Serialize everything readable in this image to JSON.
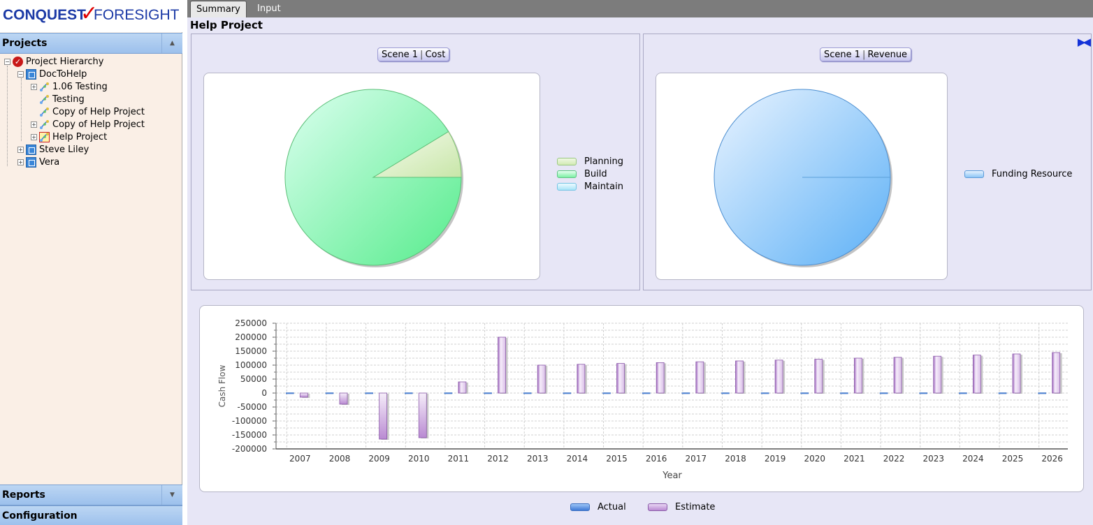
{
  "app": {
    "logo_part1": "CONQUEST",
    "logo_part2": "FORESIGHT"
  },
  "left_panel": {
    "projects_header": "Projects",
    "reports_header": "Reports",
    "configuration_header": "Configuration",
    "tree": [
      {
        "label": "Project Hierarchy",
        "icon": "checkmark-icon",
        "level": 0,
        "expander": "minus"
      },
      {
        "label": "DocToHelp",
        "icon": "org-icon",
        "level": 1,
        "expander": "minus"
      },
      {
        "label": "1.06 Testing",
        "icon": "project-icon",
        "level": 2,
        "expander": "plus"
      },
      {
        "label": "Testing",
        "icon": "project-icon",
        "level": 2,
        "expander": "none"
      },
      {
        "label": "Copy of Help Project",
        "icon": "project-icon",
        "level": 2,
        "expander": "none"
      },
      {
        "label": "Copy of Help Project",
        "icon": "project-icon",
        "level": 2,
        "expander": "plus"
      },
      {
        "label": "Help Project",
        "icon": "project-selected-icon",
        "level": 2,
        "expander": "plus"
      },
      {
        "label": "Steve Liley",
        "icon": "org-icon",
        "level": 1,
        "expander": "plus"
      },
      {
        "label": "Vera",
        "icon": "org-icon",
        "level": 1,
        "expander": "plus"
      }
    ]
  },
  "tabs": [
    {
      "label": "Summary",
      "active": true
    },
    {
      "label": "Input",
      "active": false
    }
  ],
  "page_title": "Help Project",
  "cost_pane": {
    "scene_label": "Scene 1",
    "scene_type": "Cost"
  },
  "revenue_pane": {
    "scene_label": "Scene 1",
    "scene_type": "Revenue"
  },
  "chart_data": [
    {
      "type": "pie",
      "title": "",
      "categories": [
        "Planning",
        "Build",
        "Maintain"
      ],
      "values": [
        8.7,
        91.3,
        0
      ],
      "colors": [
        "#dceec4",
        "#7cf0a4",
        "#a8e4f8"
      ],
      "legend_position": "right"
    },
    {
      "type": "pie",
      "title": "",
      "categories": [
        "Funding Resource"
      ],
      "values": [
        100
      ],
      "colors": [
        "#8ec6f6"
      ],
      "legend_position": "right"
    },
    {
      "type": "bar",
      "title": "",
      "xlabel": "Year",
      "ylabel": "Cash Flow",
      "ylim": [
        -200000,
        250000
      ],
      "yticks": [
        "250000",
        "200000",
        "150000",
        "100000",
        "50000",
        "0",
        "-50000",
        "-100000",
        "-150000",
        "-200000"
      ],
      "categories": [
        "2007",
        "2008",
        "2009",
        "2010",
        "2011",
        "2012",
        "2013",
        "2014",
        "2015",
        "2016",
        "2017",
        "2018",
        "2019",
        "2020",
        "2021",
        "2022",
        "2023",
        "2024",
        "2025",
        "2026"
      ],
      "series": [
        {
          "name": "Actual",
          "color": "#5590e0",
          "values": [
            0,
            0,
            0,
            0,
            0,
            0,
            0,
            0,
            0,
            0,
            0,
            0,
            0,
            0,
            0,
            0,
            0,
            0,
            0,
            0
          ]
        },
        {
          "name": "Estimate",
          "color": "#b98ad2",
          "values": [
            -15000,
            -40000,
            -165000,
            -160000,
            40000,
            200000,
            100000,
            103000,
            106000,
            109000,
            112000,
            115000,
            118000,
            121000,
            125000,
            128000,
            132000,
            136000,
            140000,
            145000
          ]
        }
      ],
      "grid": true,
      "legend_position": "bottom"
    }
  ]
}
